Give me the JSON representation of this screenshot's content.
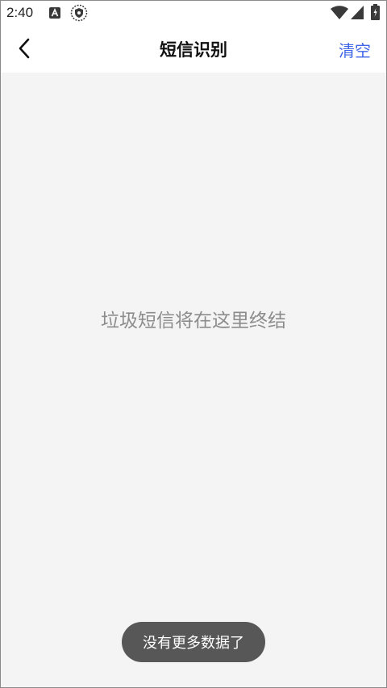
{
  "status_bar": {
    "time": "2:40",
    "icons": [
      "notification-a-icon",
      "shield-icon",
      "wifi-icon",
      "signal-icon",
      "battery-icon"
    ]
  },
  "nav": {
    "back_icon": "chevron-left-icon",
    "title": "短信识别",
    "clear_label": "清空",
    "accent_color": "#3f66e6"
  },
  "content": {
    "empty_message": "垃圾短信将在这里终结"
  },
  "toast": {
    "message": "没有更多数据了"
  }
}
